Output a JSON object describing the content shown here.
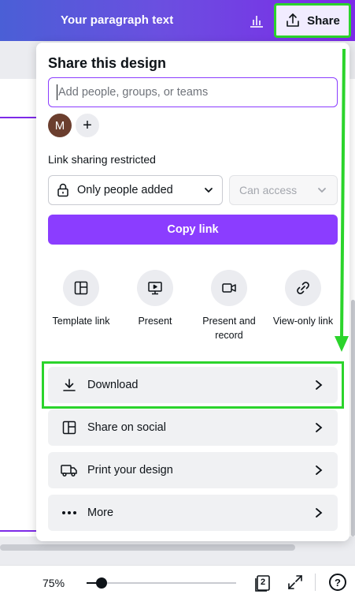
{
  "topbar": {
    "title": "Your paragraph text",
    "share_label": "Share",
    "chart_icon": "bar-chart-icon",
    "share_icon": "upload-share-icon"
  },
  "share_panel": {
    "title": "Share this design",
    "people_placeholder": "Add people, groups, or teams",
    "avatar_initial": "M",
    "add_person_label": "+",
    "link_section_label": "Link sharing restricted",
    "access_value": "Only people added",
    "permission_value": "Can access",
    "copy_link_label": "Copy link",
    "quick_actions": [
      {
        "label": "Template link",
        "icon": "template-icon"
      },
      {
        "label": "Present",
        "icon": "present-icon"
      },
      {
        "label": "Present and record",
        "icon": "record-icon"
      },
      {
        "label": "View-only link",
        "icon": "link-icon"
      }
    ],
    "rows": [
      {
        "label": "Download",
        "icon": "download-icon"
      },
      {
        "label": "Share on social",
        "icon": "social-icon"
      },
      {
        "label": "Print your design",
        "icon": "truck-icon"
      },
      {
        "label": "More",
        "icon": "more-icon"
      }
    ]
  },
  "bottombar": {
    "zoom": "75%",
    "zoom_level": 0.1,
    "pages": "2",
    "help": "?"
  },
  "colors": {
    "accent": "#8b3dff",
    "highlight": "#2bd42b"
  }
}
